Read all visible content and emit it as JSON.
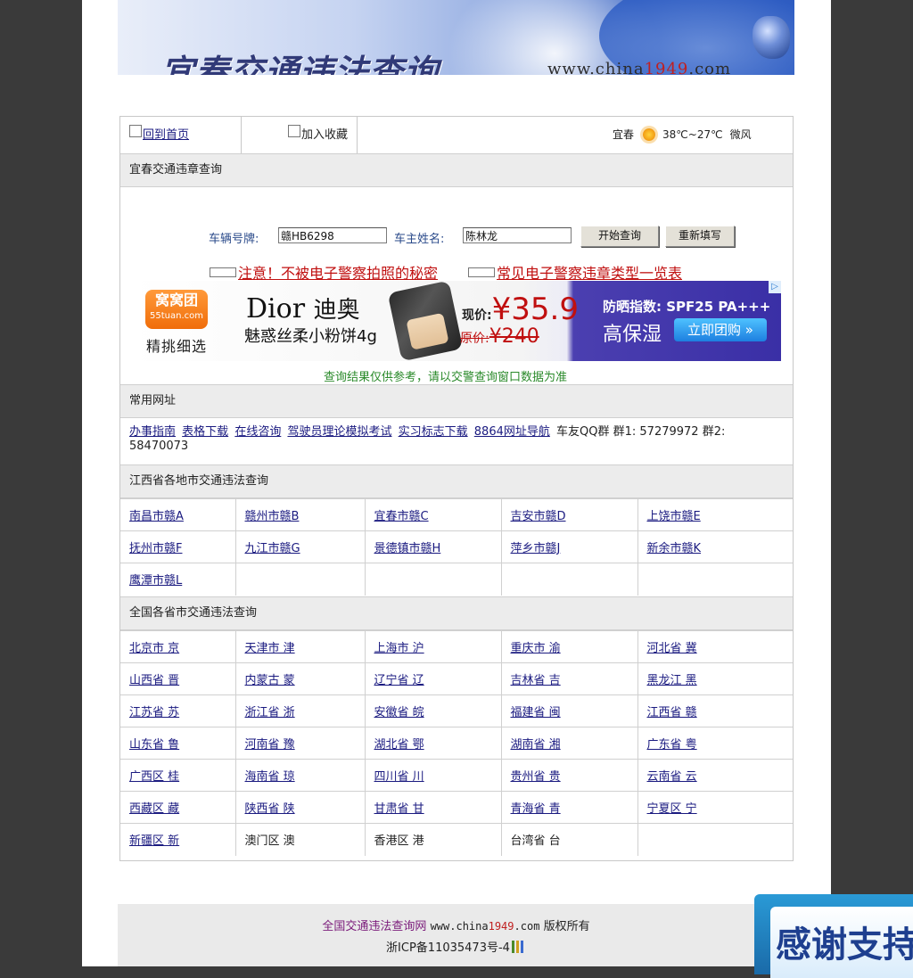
{
  "banner": {
    "title": "宜春交通违法查询",
    "url_prefix": "www.china",
    "url_highlight": "1949",
    "url_suffix": ".com"
  },
  "topbar": {
    "home_label": "回到首页",
    "favorite_label": "加入收藏",
    "weather": {
      "city": "宜春",
      "icon": "sun-icon",
      "temp": "38℃~27℃",
      "wind": "微风"
    }
  },
  "query_section": {
    "header": "宜春交通违章查询",
    "plate_label": "车辆号牌:",
    "plate_value": "赣HB6298",
    "owner_label": "车主姓名:",
    "owner_value": "陈林龙",
    "search_button": "开始查询",
    "reset_button": "重新填写",
    "notice_1": "注意！不被电子警察拍照的秘密",
    "notice_2": "常见电子警察违章类型一览表",
    "disclaimer": "查询结果仅供参考，请以交警查询窗口数据为准"
  },
  "ad": {
    "logo_top": "窝窝团",
    "logo_bottom": "55tuan.com",
    "slogan": "精挑细选",
    "brand": "Dior",
    "brand_cn": "迪奥",
    "product": "魅惑丝柔小粉饼4g",
    "now_label": "现价:",
    "now_price": "¥35.9",
    "orig_label": "原价:",
    "orig_price": "¥240",
    "spf": "防晒指数: SPF25 PA+++",
    "feature": "高保湿",
    "cta": "立即团购 »",
    "colors": {
      "orange": "#f06d0a",
      "purple": "#3a2fa6",
      "price_red": "#c01010"
    }
  },
  "common_links": {
    "header": "常用网址",
    "items": [
      "办事指南",
      "表格下载",
      "在线咨询",
      "驾驶员理论模拟考试",
      "实习标志下载",
      "8864网址导航"
    ],
    "qq_text": "车友QQ群 群1: 57279972 群2: 58470073"
  },
  "jiangxi": {
    "header": "江西省各地市交通违法查询",
    "rows": [
      [
        "南昌市赣A",
        "赣州市赣B",
        "宜春市赣C",
        "吉安市赣D",
        "上饶市赣E"
      ],
      [
        "抚州市赣F",
        "九江市赣G",
        "景德镇市赣H",
        "萍乡市赣J",
        "新余市赣K"
      ],
      [
        "鹰潭市赣L",
        "",
        "",
        "",
        ""
      ]
    ]
  },
  "national": {
    "header": "全国各省市交通违法查询",
    "rows": [
      [
        "北京市 京",
        "天津市 津",
        "上海市 沪",
        "重庆市 渝",
        "河北省 冀"
      ],
      [
        "山西省 晋",
        "内蒙古 蒙",
        "辽宁省 辽",
        "吉林省 吉",
        "黑龙江 黑"
      ],
      [
        "江苏省 苏",
        "浙江省 浙",
        "安徽省 皖",
        "福建省 闽",
        "江西省 赣"
      ],
      [
        "山东省 鲁",
        "河南省 豫",
        "湖北省 鄂",
        "湖南省 湘",
        "广东省 粤"
      ],
      [
        "广西区 桂",
        "海南省 琼",
        "四川省 川",
        "贵州省 贵",
        "云南省 云"
      ],
      [
        "西藏区 藏",
        "陕西省 陕",
        "甘肃省 甘",
        "青海省 青",
        "宁夏区 宁"
      ],
      [
        "新疆区 新",
        "澳门区 澳",
        "香港区 港",
        "台湾省 台",
        ""
      ]
    ],
    "non_link_cells": [
      "澳门区 澳",
      "香港区 港",
      "台湾省 台"
    ]
  },
  "footer": {
    "site_name": "全国交通违法查询网",
    "url_prefix": "www.china",
    "url_highlight": "1949",
    "url_suffix": ".com",
    "rights": "版权所有",
    "icp": "浙ICP备11035473号-4"
  },
  "thanks_badge": {
    "text": "感谢支持"
  }
}
